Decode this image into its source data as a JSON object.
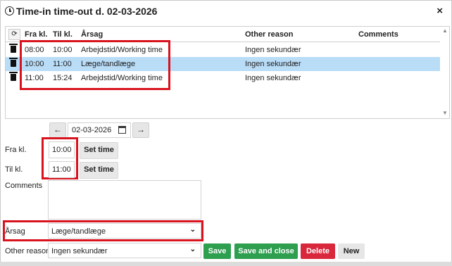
{
  "dialog": {
    "title": "Time-in time-out d. 02-03-2026",
    "close_icon": "×"
  },
  "grid": {
    "columns": [
      "Fra kl.",
      "Til kl.",
      "Årsag",
      "Other reason",
      "Comments"
    ],
    "rows": [
      {
        "from": "08:00",
        "to": "10:00",
        "reason": "Arbejdstid/Working time",
        "other": "Ingen sekundær",
        "comments": ""
      },
      {
        "from": "10:00",
        "to": "11:00",
        "reason": "Læge/tandlæge",
        "other": "Ingen sekundær",
        "comments": ""
      },
      {
        "from": "11:00",
        "to": "15:24",
        "reason": "Arbejdstid/Working time",
        "other": "Ingen sekundær",
        "comments": ""
      }
    ],
    "selected_row": 1
  },
  "date_nav": {
    "prev": "←",
    "date": "02-03-2026",
    "next": "→"
  },
  "form": {
    "from_label": "Fra kl.",
    "from_value": "10:00",
    "to_label": "Til kl.",
    "to_value": "11:00",
    "set_time_label": "Set time",
    "comments_label": "Comments",
    "reason_label": "Årsag",
    "reason_value": "Læge/tandlæge",
    "other_label": "Other reason",
    "other_value": "Ingen sekundær"
  },
  "actions": {
    "save": "Save",
    "save_close": "Save and close",
    "delete": "Delete",
    "new": "New"
  },
  "colors": {
    "save": "#2e9e4f",
    "delete": "#d9273c",
    "new": "#e6e6e6",
    "highlight": "#d9131e",
    "selected": "#b9dcf7"
  }
}
